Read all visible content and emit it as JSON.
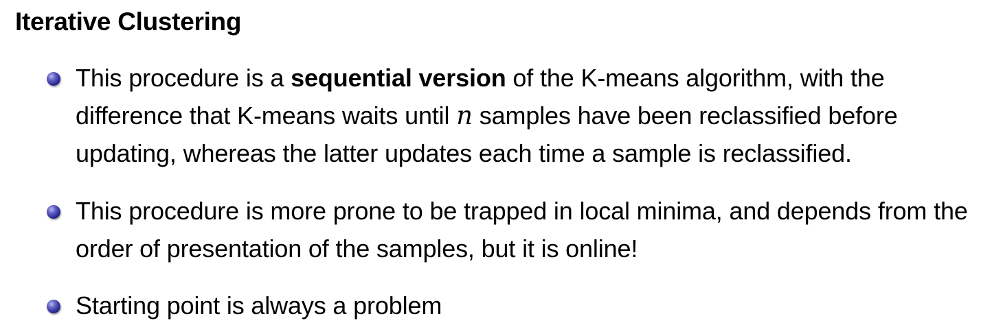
{
  "slide": {
    "title": "Iterative Clustering",
    "bullets": [
      {
        "pre": "This procedure is a ",
        "bold": "sequential version",
        "mid": " of the K-means algorithm, with the difference that K-means waits until ",
        "math": "n",
        "post": " samples have been reclassified before updating, whereas the latter updates each time a sample is reclassified."
      },
      {
        "text": "This procedure is more prone to be trapped in local minima, and depends from the order of presentation of the samples, but it is online!"
      },
      {
        "text": "Starting point is always a problem"
      }
    ],
    "bullet_icon": "ball-bullet-icon",
    "colors": {
      "bullet": "#2e2e96",
      "text": "#000000",
      "background": "#ffffff"
    }
  }
}
